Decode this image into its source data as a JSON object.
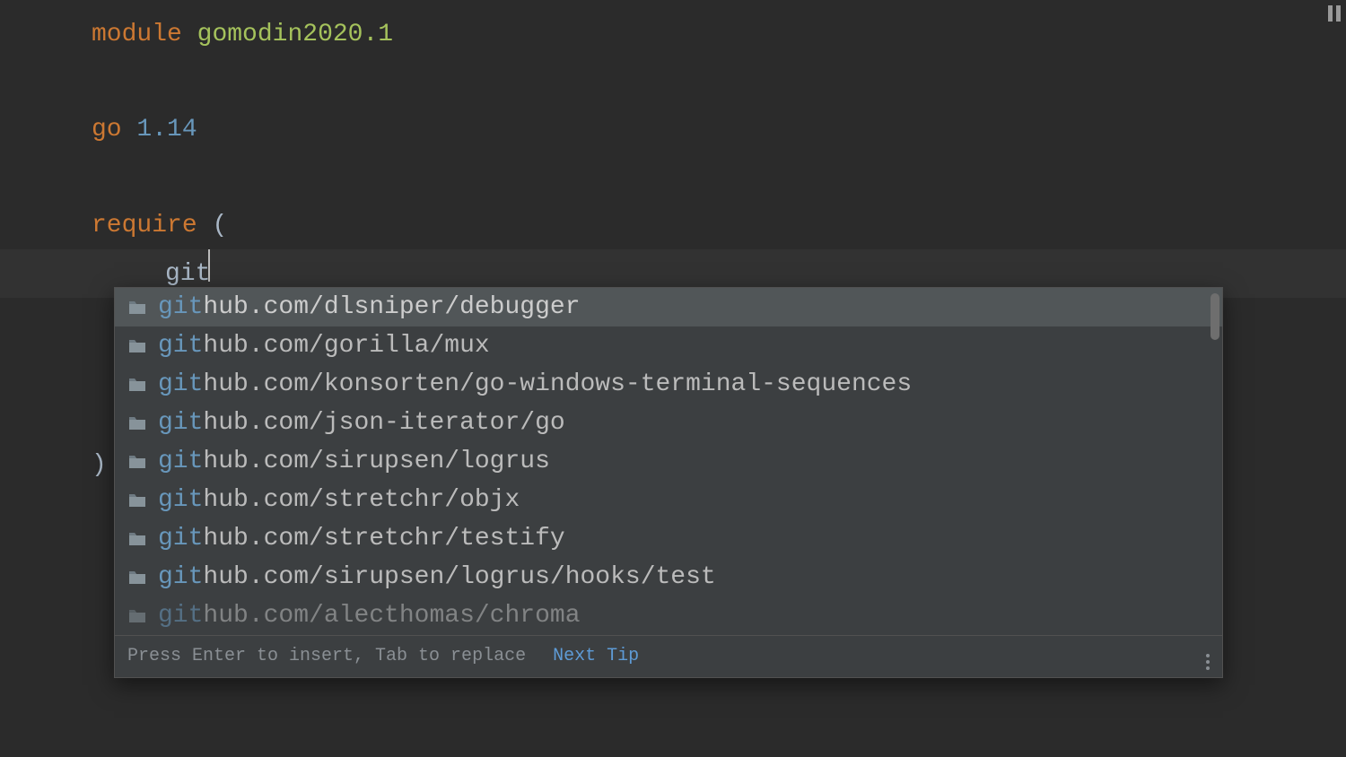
{
  "code": {
    "module_keyword": "module",
    "module_name": "gomodin2020.1",
    "go_keyword": "go",
    "go_version": "1.14",
    "require_keyword": "require",
    "open_paren": "(",
    "typed": "git",
    "close_paren": ")"
  },
  "completion": {
    "match_prefix": "git",
    "items": [
      {
        "rest": "hub.com/dlsniper/debugger"
      },
      {
        "rest": "hub.com/gorilla/mux"
      },
      {
        "rest": "hub.com/konsorten/go-windows-terminal-sequences"
      },
      {
        "rest": "hub.com/json-iterator/go"
      },
      {
        "rest": "hub.com/sirupsen/logrus"
      },
      {
        "rest": "hub.com/stretchr/objx"
      },
      {
        "rest": "hub.com/stretchr/testify"
      },
      {
        "rest": "hub.com/sirupsen/logrus/hooks/test"
      },
      {
        "rest": "hub.com/alecthomas/chroma"
      }
    ],
    "selected_index": 0
  },
  "footer": {
    "hint": "Press Enter to insert, Tab to replace",
    "next_tip": "Next Tip"
  }
}
